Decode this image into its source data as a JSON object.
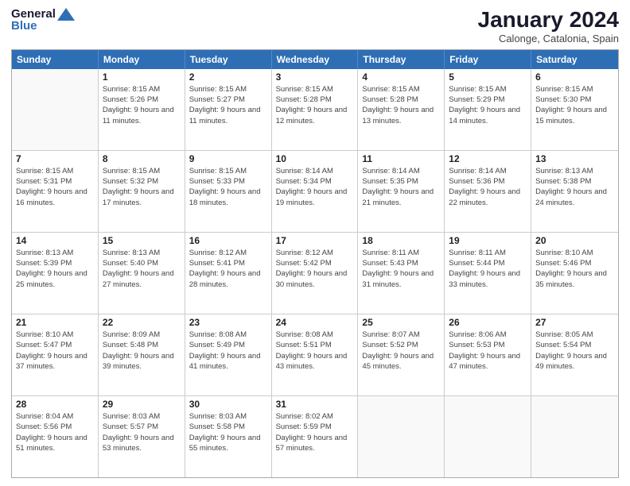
{
  "logo": {
    "line1": "General",
    "line2": "Blue"
  },
  "title": "January 2024",
  "subtitle": "Calonge, Catalonia, Spain",
  "header_days": [
    "Sunday",
    "Monday",
    "Tuesday",
    "Wednesday",
    "Thursday",
    "Friday",
    "Saturday"
  ],
  "weeks": [
    [
      {
        "day": "",
        "sunrise": "",
        "sunset": "",
        "daylight": ""
      },
      {
        "day": "1",
        "sunrise": "Sunrise: 8:15 AM",
        "sunset": "Sunset: 5:26 PM",
        "daylight": "Daylight: 9 hours and 11 minutes."
      },
      {
        "day": "2",
        "sunrise": "Sunrise: 8:15 AM",
        "sunset": "Sunset: 5:27 PM",
        "daylight": "Daylight: 9 hours and 11 minutes."
      },
      {
        "day": "3",
        "sunrise": "Sunrise: 8:15 AM",
        "sunset": "Sunset: 5:28 PM",
        "daylight": "Daylight: 9 hours and 12 minutes."
      },
      {
        "day": "4",
        "sunrise": "Sunrise: 8:15 AM",
        "sunset": "Sunset: 5:28 PM",
        "daylight": "Daylight: 9 hours and 13 minutes."
      },
      {
        "day": "5",
        "sunrise": "Sunrise: 8:15 AM",
        "sunset": "Sunset: 5:29 PM",
        "daylight": "Daylight: 9 hours and 14 minutes."
      },
      {
        "day": "6",
        "sunrise": "Sunrise: 8:15 AM",
        "sunset": "Sunset: 5:30 PM",
        "daylight": "Daylight: 9 hours and 15 minutes."
      }
    ],
    [
      {
        "day": "7",
        "sunrise": "Sunrise: 8:15 AM",
        "sunset": "Sunset: 5:31 PM",
        "daylight": "Daylight: 9 hours and 16 minutes."
      },
      {
        "day": "8",
        "sunrise": "Sunrise: 8:15 AM",
        "sunset": "Sunset: 5:32 PM",
        "daylight": "Daylight: 9 hours and 17 minutes."
      },
      {
        "day": "9",
        "sunrise": "Sunrise: 8:15 AM",
        "sunset": "Sunset: 5:33 PM",
        "daylight": "Daylight: 9 hours and 18 minutes."
      },
      {
        "day": "10",
        "sunrise": "Sunrise: 8:14 AM",
        "sunset": "Sunset: 5:34 PM",
        "daylight": "Daylight: 9 hours and 19 minutes."
      },
      {
        "day": "11",
        "sunrise": "Sunrise: 8:14 AM",
        "sunset": "Sunset: 5:35 PM",
        "daylight": "Daylight: 9 hours and 21 minutes."
      },
      {
        "day": "12",
        "sunrise": "Sunrise: 8:14 AM",
        "sunset": "Sunset: 5:36 PM",
        "daylight": "Daylight: 9 hours and 22 minutes."
      },
      {
        "day": "13",
        "sunrise": "Sunrise: 8:13 AM",
        "sunset": "Sunset: 5:38 PM",
        "daylight": "Daylight: 9 hours and 24 minutes."
      }
    ],
    [
      {
        "day": "14",
        "sunrise": "Sunrise: 8:13 AM",
        "sunset": "Sunset: 5:39 PM",
        "daylight": "Daylight: 9 hours and 25 minutes."
      },
      {
        "day": "15",
        "sunrise": "Sunrise: 8:13 AM",
        "sunset": "Sunset: 5:40 PM",
        "daylight": "Daylight: 9 hours and 27 minutes."
      },
      {
        "day": "16",
        "sunrise": "Sunrise: 8:12 AM",
        "sunset": "Sunset: 5:41 PM",
        "daylight": "Daylight: 9 hours and 28 minutes."
      },
      {
        "day": "17",
        "sunrise": "Sunrise: 8:12 AM",
        "sunset": "Sunset: 5:42 PM",
        "daylight": "Daylight: 9 hours and 30 minutes."
      },
      {
        "day": "18",
        "sunrise": "Sunrise: 8:11 AM",
        "sunset": "Sunset: 5:43 PM",
        "daylight": "Daylight: 9 hours and 31 minutes."
      },
      {
        "day": "19",
        "sunrise": "Sunrise: 8:11 AM",
        "sunset": "Sunset: 5:44 PM",
        "daylight": "Daylight: 9 hours and 33 minutes."
      },
      {
        "day": "20",
        "sunrise": "Sunrise: 8:10 AM",
        "sunset": "Sunset: 5:46 PM",
        "daylight": "Daylight: 9 hours and 35 minutes."
      }
    ],
    [
      {
        "day": "21",
        "sunrise": "Sunrise: 8:10 AM",
        "sunset": "Sunset: 5:47 PM",
        "daylight": "Daylight: 9 hours and 37 minutes."
      },
      {
        "day": "22",
        "sunrise": "Sunrise: 8:09 AM",
        "sunset": "Sunset: 5:48 PM",
        "daylight": "Daylight: 9 hours and 39 minutes."
      },
      {
        "day": "23",
        "sunrise": "Sunrise: 8:08 AM",
        "sunset": "Sunset: 5:49 PM",
        "daylight": "Daylight: 9 hours and 41 minutes."
      },
      {
        "day": "24",
        "sunrise": "Sunrise: 8:08 AM",
        "sunset": "Sunset: 5:51 PM",
        "daylight": "Daylight: 9 hours and 43 minutes."
      },
      {
        "day": "25",
        "sunrise": "Sunrise: 8:07 AM",
        "sunset": "Sunset: 5:52 PM",
        "daylight": "Daylight: 9 hours and 45 minutes."
      },
      {
        "day": "26",
        "sunrise": "Sunrise: 8:06 AM",
        "sunset": "Sunset: 5:53 PM",
        "daylight": "Daylight: 9 hours and 47 minutes."
      },
      {
        "day": "27",
        "sunrise": "Sunrise: 8:05 AM",
        "sunset": "Sunset: 5:54 PM",
        "daylight": "Daylight: 9 hours and 49 minutes."
      }
    ],
    [
      {
        "day": "28",
        "sunrise": "Sunrise: 8:04 AM",
        "sunset": "Sunset: 5:56 PM",
        "daylight": "Daylight: 9 hours and 51 minutes."
      },
      {
        "day": "29",
        "sunrise": "Sunrise: 8:03 AM",
        "sunset": "Sunset: 5:57 PM",
        "daylight": "Daylight: 9 hours and 53 minutes."
      },
      {
        "day": "30",
        "sunrise": "Sunrise: 8:03 AM",
        "sunset": "Sunset: 5:58 PM",
        "daylight": "Daylight: 9 hours and 55 minutes."
      },
      {
        "day": "31",
        "sunrise": "Sunrise: 8:02 AM",
        "sunset": "Sunset: 5:59 PM",
        "daylight": "Daylight: 9 hours and 57 minutes."
      },
      {
        "day": "",
        "sunrise": "",
        "sunset": "",
        "daylight": ""
      },
      {
        "day": "",
        "sunrise": "",
        "sunset": "",
        "daylight": ""
      },
      {
        "day": "",
        "sunrise": "",
        "sunset": "",
        "daylight": ""
      }
    ]
  ]
}
